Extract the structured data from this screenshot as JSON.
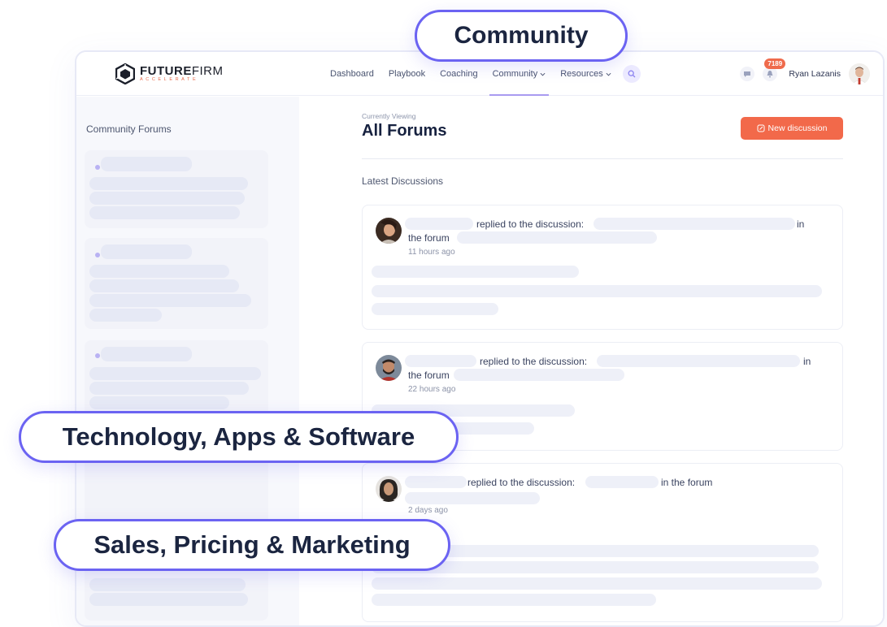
{
  "logo": {
    "main_bold": "FUTURE",
    "main_thin": "FIRM",
    "sub": "ACCELERATE"
  },
  "nav": {
    "items": [
      {
        "label": "Dashboard"
      },
      {
        "label": "Playbook"
      },
      {
        "label": "Coaching"
      },
      {
        "label": "Community",
        "active": true
      },
      {
        "label": "Resources"
      }
    ]
  },
  "header": {
    "notifications_count": "7189",
    "user_name": "Ryan Lazanis"
  },
  "sidebar": {
    "title": "Community Forums"
  },
  "main": {
    "currently_viewing_label": "Currently Viewing",
    "title": "All Forums",
    "new_discussion_label": "New discussion",
    "latest_label": "Latest Discussions",
    "discussions": [
      {
        "replied_text": "replied to the discussion:",
        "in_text": "in",
        "forum_text": "the forum",
        "time": "11 hours ago"
      },
      {
        "replied_text": "replied to the discussion:",
        "in_text": "in",
        "forum_text": "the forum",
        "time": "22 hours ago"
      },
      {
        "replied_text": "replied to the discussion:",
        "in_text": "in the forum",
        "time": "2 days ago"
      }
    ]
  },
  "callouts": {
    "community": "Community",
    "technology": "Technology, Apps & Software",
    "sales": "Sales, Pricing & Marketing"
  },
  "colors": {
    "accent": "#6b63f2",
    "brand_orange": "#f2694a",
    "nav_active_underline": "#a99bf0"
  }
}
